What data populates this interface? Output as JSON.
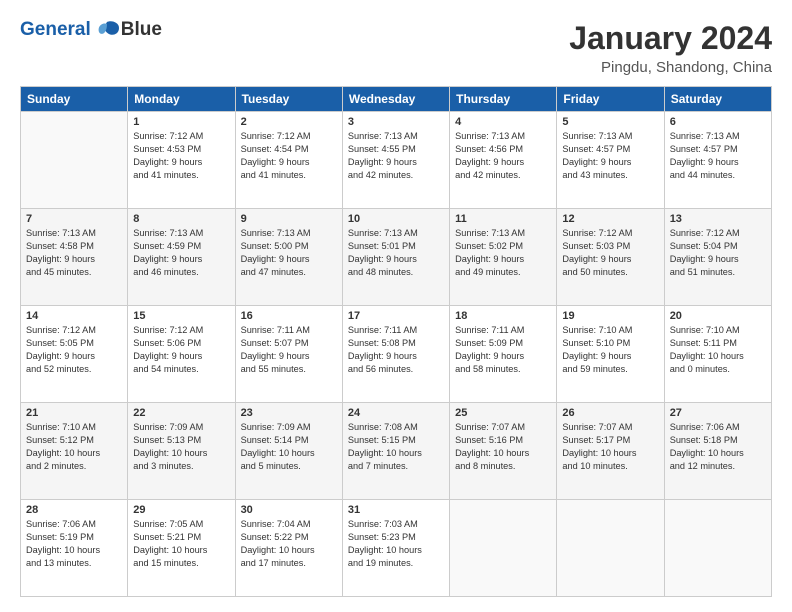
{
  "header": {
    "logo_line1": "General",
    "logo_line2": "Blue",
    "title": "January 2024",
    "location": "Pingdu, Shandong, China"
  },
  "weekdays": [
    "Sunday",
    "Monday",
    "Tuesday",
    "Wednesday",
    "Thursday",
    "Friday",
    "Saturday"
  ],
  "weeks": [
    [
      {
        "day": "",
        "info": ""
      },
      {
        "day": "1",
        "info": "Sunrise: 7:12 AM\nSunset: 4:53 PM\nDaylight: 9 hours\nand 41 minutes."
      },
      {
        "day": "2",
        "info": "Sunrise: 7:12 AM\nSunset: 4:54 PM\nDaylight: 9 hours\nand 41 minutes."
      },
      {
        "day": "3",
        "info": "Sunrise: 7:13 AM\nSunset: 4:55 PM\nDaylight: 9 hours\nand 42 minutes."
      },
      {
        "day": "4",
        "info": "Sunrise: 7:13 AM\nSunset: 4:56 PM\nDaylight: 9 hours\nand 42 minutes."
      },
      {
        "day": "5",
        "info": "Sunrise: 7:13 AM\nSunset: 4:57 PM\nDaylight: 9 hours\nand 43 minutes."
      },
      {
        "day": "6",
        "info": "Sunrise: 7:13 AM\nSunset: 4:57 PM\nDaylight: 9 hours\nand 44 minutes."
      }
    ],
    [
      {
        "day": "7",
        "info": "Sunrise: 7:13 AM\nSunset: 4:58 PM\nDaylight: 9 hours\nand 45 minutes."
      },
      {
        "day": "8",
        "info": "Sunrise: 7:13 AM\nSunset: 4:59 PM\nDaylight: 9 hours\nand 46 minutes."
      },
      {
        "day": "9",
        "info": "Sunrise: 7:13 AM\nSunset: 5:00 PM\nDaylight: 9 hours\nand 47 minutes."
      },
      {
        "day": "10",
        "info": "Sunrise: 7:13 AM\nSunset: 5:01 PM\nDaylight: 9 hours\nand 48 minutes."
      },
      {
        "day": "11",
        "info": "Sunrise: 7:13 AM\nSunset: 5:02 PM\nDaylight: 9 hours\nand 49 minutes."
      },
      {
        "day": "12",
        "info": "Sunrise: 7:12 AM\nSunset: 5:03 PM\nDaylight: 9 hours\nand 50 minutes."
      },
      {
        "day": "13",
        "info": "Sunrise: 7:12 AM\nSunset: 5:04 PM\nDaylight: 9 hours\nand 51 minutes."
      }
    ],
    [
      {
        "day": "14",
        "info": "Sunrise: 7:12 AM\nSunset: 5:05 PM\nDaylight: 9 hours\nand 52 minutes."
      },
      {
        "day": "15",
        "info": "Sunrise: 7:12 AM\nSunset: 5:06 PM\nDaylight: 9 hours\nand 54 minutes."
      },
      {
        "day": "16",
        "info": "Sunrise: 7:11 AM\nSunset: 5:07 PM\nDaylight: 9 hours\nand 55 minutes."
      },
      {
        "day": "17",
        "info": "Sunrise: 7:11 AM\nSunset: 5:08 PM\nDaylight: 9 hours\nand 56 minutes."
      },
      {
        "day": "18",
        "info": "Sunrise: 7:11 AM\nSunset: 5:09 PM\nDaylight: 9 hours\nand 58 minutes."
      },
      {
        "day": "19",
        "info": "Sunrise: 7:10 AM\nSunset: 5:10 PM\nDaylight: 9 hours\nand 59 minutes."
      },
      {
        "day": "20",
        "info": "Sunrise: 7:10 AM\nSunset: 5:11 PM\nDaylight: 10 hours\nand 0 minutes."
      }
    ],
    [
      {
        "day": "21",
        "info": "Sunrise: 7:10 AM\nSunset: 5:12 PM\nDaylight: 10 hours\nand 2 minutes."
      },
      {
        "day": "22",
        "info": "Sunrise: 7:09 AM\nSunset: 5:13 PM\nDaylight: 10 hours\nand 3 minutes."
      },
      {
        "day": "23",
        "info": "Sunrise: 7:09 AM\nSunset: 5:14 PM\nDaylight: 10 hours\nand 5 minutes."
      },
      {
        "day": "24",
        "info": "Sunrise: 7:08 AM\nSunset: 5:15 PM\nDaylight: 10 hours\nand 7 minutes."
      },
      {
        "day": "25",
        "info": "Sunrise: 7:07 AM\nSunset: 5:16 PM\nDaylight: 10 hours\nand 8 minutes."
      },
      {
        "day": "26",
        "info": "Sunrise: 7:07 AM\nSunset: 5:17 PM\nDaylight: 10 hours\nand 10 minutes."
      },
      {
        "day": "27",
        "info": "Sunrise: 7:06 AM\nSunset: 5:18 PM\nDaylight: 10 hours\nand 12 minutes."
      }
    ],
    [
      {
        "day": "28",
        "info": "Sunrise: 7:06 AM\nSunset: 5:19 PM\nDaylight: 10 hours\nand 13 minutes."
      },
      {
        "day": "29",
        "info": "Sunrise: 7:05 AM\nSunset: 5:21 PM\nDaylight: 10 hours\nand 15 minutes."
      },
      {
        "day": "30",
        "info": "Sunrise: 7:04 AM\nSunset: 5:22 PM\nDaylight: 10 hours\nand 17 minutes."
      },
      {
        "day": "31",
        "info": "Sunrise: 7:03 AM\nSunset: 5:23 PM\nDaylight: 10 hours\nand 19 minutes."
      },
      {
        "day": "",
        "info": ""
      },
      {
        "day": "",
        "info": ""
      },
      {
        "day": "",
        "info": ""
      }
    ]
  ]
}
